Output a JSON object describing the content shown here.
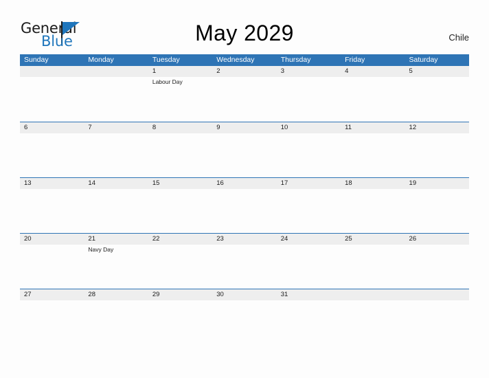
{
  "brand": {
    "word_one": "General",
    "word_two": "Blue",
    "triangle_icon": "triangle-icon"
  },
  "header": {
    "title": "May 2029",
    "country": "Chile"
  },
  "colors": {
    "header_blue": "#2e74b5",
    "band_gray": "#eeeeee",
    "brand_blue": "#1f76bc",
    "text_dark": "#1a1a1a"
  },
  "calendar": {
    "weekday_headers": [
      "Sunday",
      "Monday",
      "Tuesday",
      "Wednesday",
      "Thursday",
      "Friday",
      "Saturday"
    ],
    "weeks": [
      {
        "days": [
          {
            "number": "",
            "events": []
          },
          {
            "number": "",
            "events": []
          },
          {
            "number": "1",
            "events": [
              "Labour Day"
            ]
          },
          {
            "number": "2",
            "events": []
          },
          {
            "number": "3",
            "events": []
          },
          {
            "number": "4",
            "events": []
          },
          {
            "number": "5",
            "events": []
          }
        ]
      },
      {
        "days": [
          {
            "number": "6",
            "events": []
          },
          {
            "number": "7",
            "events": []
          },
          {
            "number": "8",
            "events": []
          },
          {
            "number": "9",
            "events": []
          },
          {
            "number": "10",
            "events": []
          },
          {
            "number": "11",
            "events": []
          },
          {
            "number": "12",
            "events": []
          }
        ]
      },
      {
        "days": [
          {
            "number": "13",
            "events": []
          },
          {
            "number": "14",
            "events": []
          },
          {
            "number": "15",
            "events": []
          },
          {
            "number": "16",
            "events": []
          },
          {
            "number": "17",
            "events": []
          },
          {
            "number": "18",
            "events": []
          },
          {
            "number": "19",
            "events": []
          }
        ]
      },
      {
        "days": [
          {
            "number": "20",
            "events": []
          },
          {
            "number": "21",
            "events": [
              "Navy Day"
            ]
          },
          {
            "number": "22",
            "events": []
          },
          {
            "number": "23",
            "events": []
          },
          {
            "number": "24",
            "events": []
          },
          {
            "number": "25",
            "events": []
          },
          {
            "number": "26",
            "events": []
          }
        ]
      },
      {
        "days": [
          {
            "number": "27",
            "events": []
          },
          {
            "number": "28",
            "events": []
          },
          {
            "number": "29",
            "events": []
          },
          {
            "number": "30",
            "events": []
          },
          {
            "number": "31",
            "events": []
          },
          {
            "number": "",
            "events": []
          },
          {
            "number": "",
            "events": []
          }
        ]
      }
    ]
  }
}
